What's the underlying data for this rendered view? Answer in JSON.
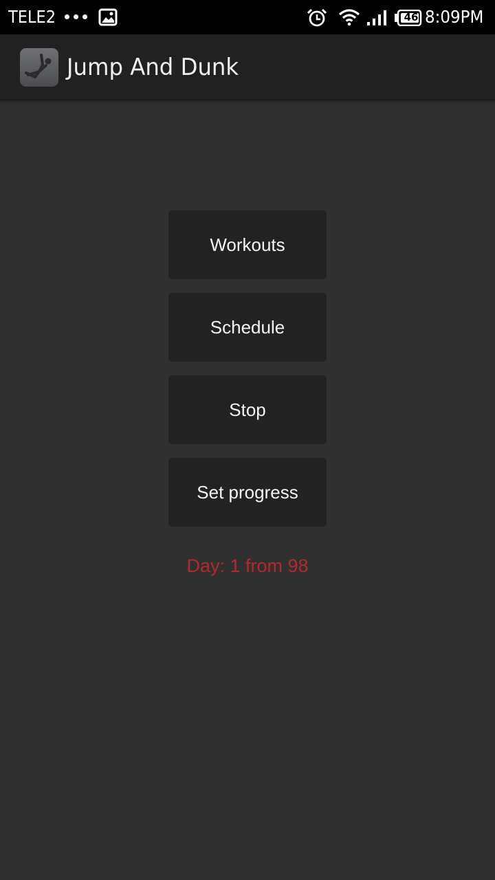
{
  "status_bar": {
    "carrier": "TELE2",
    "notification_icons": [
      "more-dots-icon",
      "gallery-icon"
    ],
    "system_icons": [
      "alarm-icon",
      "wifi-icon",
      "signal-icon",
      "battery-icon"
    ],
    "battery_level": "46",
    "time": "8:09PM"
  },
  "action_bar": {
    "app_icon": "jumping-figure-icon",
    "title": "Jump And Dunk"
  },
  "menu": {
    "buttons": [
      {
        "label": "Workouts"
      },
      {
        "label": "Schedule"
      },
      {
        "label": "Stop"
      },
      {
        "label": "Set progress"
      }
    ]
  },
  "progress": {
    "text": "Day: 1 from 98",
    "color": "#b5272f"
  }
}
